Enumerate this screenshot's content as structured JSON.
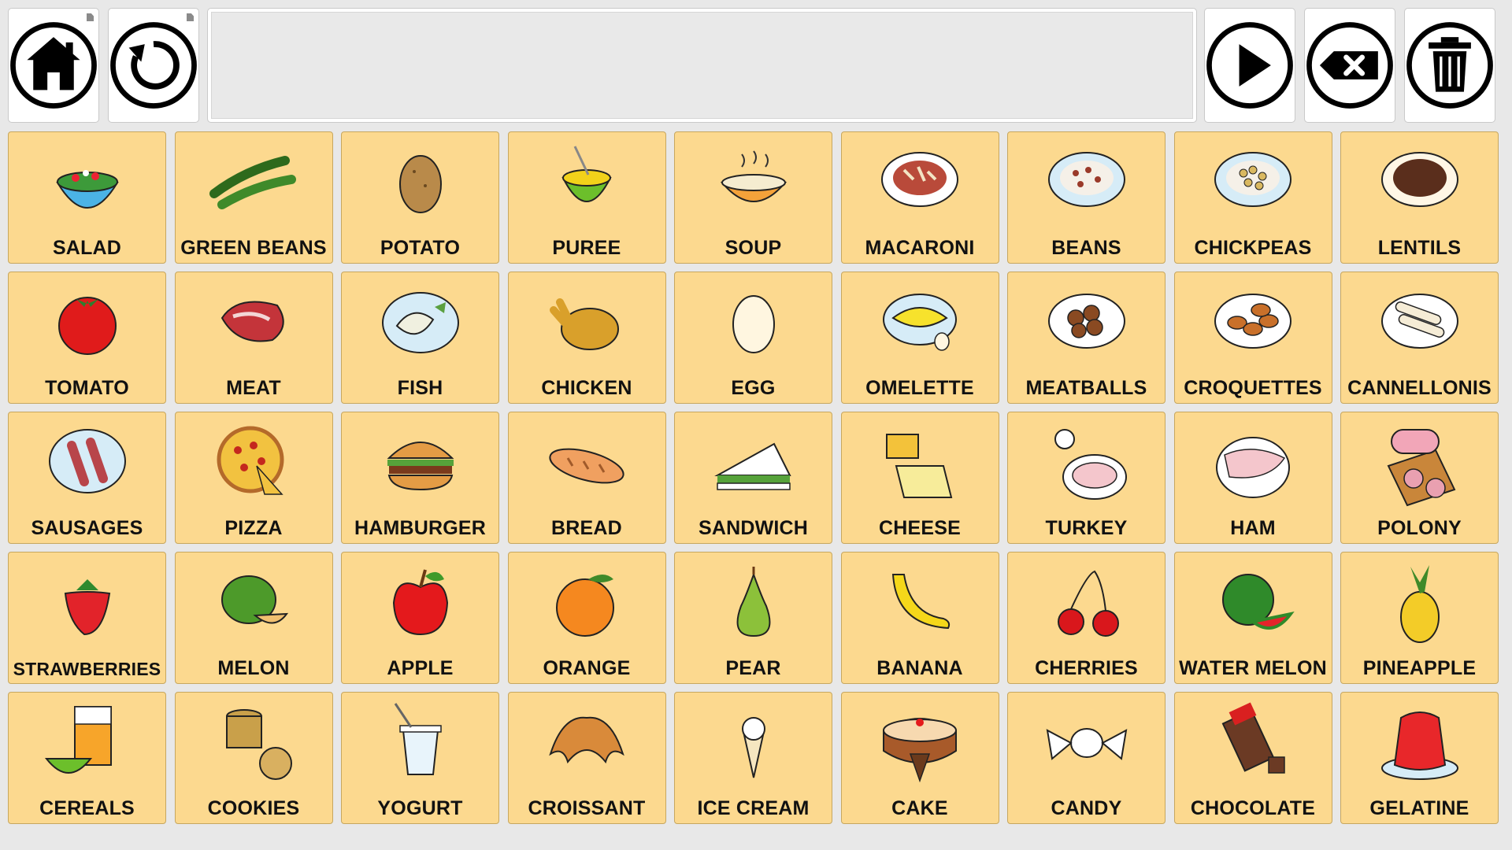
{
  "toolbar": {
    "home_icon": "home-icon",
    "refresh_icon": "refresh-icon",
    "message_text": "",
    "speak_icon": "play-icon",
    "backspace_icon": "backspace-icon",
    "clear_icon": "trash-icon"
  },
  "grid": {
    "cells": [
      {
        "label": "SALAD",
        "icon": "salad"
      },
      {
        "label": "GREEN BEANS",
        "icon": "greenbeans"
      },
      {
        "label": "POTATO",
        "icon": "potato"
      },
      {
        "label": "PUREE",
        "icon": "puree"
      },
      {
        "label": "SOUP",
        "icon": "soup"
      },
      {
        "label": "MACARONI",
        "icon": "macaroni"
      },
      {
        "label": "BEANS",
        "icon": "beans"
      },
      {
        "label": "CHICKPEAS",
        "icon": "chickpeas"
      },
      {
        "label": "LENTILS",
        "icon": "lentils"
      },
      {
        "label": "TOMATO",
        "icon": "tomato"
      },
      {
        "label": "MEAT",
        "icon": "meat"
      },
      {
        "label": "FISH",
        "icon": "fish"
      },
      {
        "label": "CHICKEN",
        "icon": "chicken"
      },
      {
        "label": "EGG",
        "icon": "egg"
      },
      {
        "label": "OMELETTE",
        "icon": "omelette"
      },
      {
        "label": "MEATBALLS",
        "icon": "meatballs"
      },
      {
        "label": "CROQUETTES",
        "icon": "croquettes"
      },
      {
        "label": "CANNELLONIS",
        "icon": "cannellonis"
      },
      {
        "label": "SAUSAGES",
        "icon": "sausages"
      },
      {
        "label": "PIZZA",
        "icon": "pizza"
      },
      {
        "label": "HAMBURGER",
        "icon": "hamburger"
      },
      {
        "label": "BREAD",
        "icon": "bread"
      },
      {
        "label": "SANDWICH",
        "icon": "sandwich"
      },
      {
        "label": "CHEESE",
        "icon": "cheese"
      },
      {
        "label": "TURKEY",
        "icon": "turkey"
      },
      {
        "label": "HAM",
        "icon": "ham"
      },
      {
        "label": "POLONY",
        "icon": "polony"
      },
      {
        "label": "STRAWBERRIES",
        "icon": "strawberry"
      },
      {
        "label": "MELON",
        "icon": "melon"
      },
      {
        "label": "APPLE",
        "icon": "apple"
      },
      {
        "label": "ORANGE",
        "icon": "orange"
      },
      {
        "label": "PEAR",
        "icon": "pear"
      },
      {
        "label": "BANANA",
        "icon": "banana"
      },
      {
        "label": "CHERRIES",
        "icon": "cherries"
      },
      {
        "label": "WATER MELON",
        "icon": "watermelon"
      },
      {
        "label": "PINEAPPLE",
        "icon": "pineapple"
      },
      {
        "label": "CEREALS",
        "icon": "cereals"
      },
      {
        "label": "COOKIES",
        "icon": "cookies"
      },
      {
        "label": "YOGURT",
        "icon": "yogurt"
      },
      {
        "label": "CROISSANT",
        "icon": "croissant"
      },
      {
        "label": "ICE CREAM",
        "icon": "icecream"
      },
      {
        "label": "CAKE",
        "icon": "cake"
      },
      {
        "label": "CANDY",
        "icon": "candy"
      },
      {
        "label": "CHOCOLATE",
        "icon": "chocolate"
      },
      {
        "label": "GELATINE",
        "icon": "gelatine"
      }
    ]
  },
  "colors": {
    "cell_background": "#fcd98f",
    "cell_border": "#c7a75f",
    "page_background": "#e8e8e8",
    "button_background": "#ffffff"
  }
}
